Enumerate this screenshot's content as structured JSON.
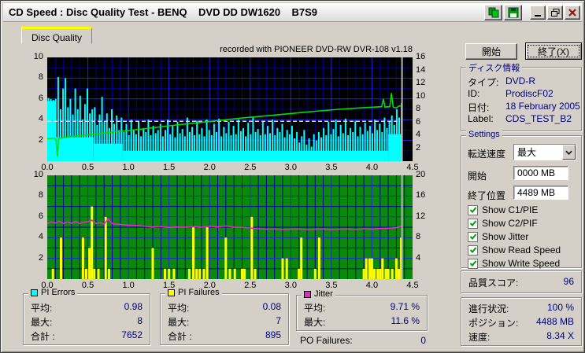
{
  "window": {
    "title": "CD Speed : Disc Quality Test - BENQ    DVD DD DW1620    B7S9"
  },
  "titlebar_icons": [
    "copy-icon",
    "save-icon",
    "minimize-icon",
    "restore-icon",
    "close-icon"
  ],
  "tab": {
    "label": "Disc Quality"
  },
  "buttons": {
    "start": "開始",
    "exit": "終了(X)"
  },
  "disc_info": {
    "title": "ディスク情報",
    "rows": [
      {
        "label": "タイプ:",
        "value": "DVD-R"
      },
      {
        "label": "ID:",
        "value": "ProdiscF02"
      },
      {
        "label": "日付:",
        "value": "18 February 2005"
      },
      {
        "label": "Label:",
        "value": "CDS_TEST_B2"
      }
    ]
  },
  "settings": {
    "title": "Settings",
    "speed_label": "転送速度",
    "speed_value": "最大",
    "start_label": "開始",
    "start_value": "0000 MB",
    "end_label": "終了位置",
    "end_value": "4489 MB",
    "checkboxes": [
      {
        "label": "Show C1/PIE",
        "checked": true
      },
      {
        "label": "Show C2/PIF",
        "checked": true
      },
      {
        "label": "Show Jitter",
        "checked": true
      },
      {
        "label": "Show Read Speed",
        "checked": true
      },
      {
        "label": "Show Write Speed",
        "checked": true
      }
    ]
  },
  "score": {
    "label": "品質スコア:",
    "value": "96"
  },
  "status": {
    "rows": [
      {
        "label": "進行状況:",
        "value": "100 %"
      },
      {
        "label": "ポジション:",
        "value": "4488 MB"
      },
      {
        "label": "速度:",
        "value": "8.34 X"
      }
    ]
  },
  "stats": {
    "pi_errors": {
      "title": "PI Errors",
      "color": "#00ffff",
      "rows": [
        {
          "label": "平均:",
          "value": "0.98"
        },
        {
          "label": "最大:",
          "value": "8"
        },
        {
          "label": "合計 :",
          "value": "7652"
        }
      ]
    },
    "pi_failures": {
      "title": "PI Failures",
      "color": "#ffff00",
      "rows": [
        {
          "label": "平均:",
          "value": "0.08"
        },
        {
          "label": "最大:",
          "value": "7"
        },
        {
          "label": "合計 :",
          "value": "895"
        }
      ]
    },
    "jitter": {
      "title": "Jitter",
      "color": "#ee22cc",
      "rows": [
        {
          "label": "平均:",
          "value": "9.71 %"
        },
        {
          "label": "最大:",
          "value": "11.6 %"
        }
      ]
    },
    "po_failures": {
      "label": "PO Failures:",
      "value": "0"
    }
  },
  "chart_data": [
    {
      "type": "bar",
      "name": "pi-errors-and-speed",
      "annotation": "recorded with PIONEER DVD-RW  DVR-108  v1.18",
      "x_range": [
        0,
        4.5
      ],
      "x_ticks": [
        "0.0",
        "0.5",
        "1.0",
        "1.5",
        "2.0",
        "2.5",
        "3.0",
        "3.5",
        "4.0",
        "4.5"
      ],
      "y_left": {
        "min": 0,
        "max": 10,
        "ticks": [
          10,
          8,
          6,
          4,
          2
        ]
      },
      "y_right": {
        "min": 0,
        "max": 16,
        "ticks": [
          16,
          14,
          12,
          10,
          8,
          6,
          4,
          2
        ]
      },
      "grid": {
        "x_minor": 0.1,
        "x_major": 0.5,
        "y_minor": 1,
        "y_major": 2
      },
      "end_marker_x": 4.37,
      "colors": {
        "bg": "#000000",
        "grid_minor": "#000088",
        "grid_major": "#2424e0",
        "pi_errors": "#00ffff",
        "read_speed": "#00dd00",
        "write_speed": "#d8d8d8",
        "end_marker": "#b8b8b8"
      },
      "pi_errors": {
        "axis": "left",
        "x_start": 0.015,
        "x_step": 0.03,
        "values": [
          6.1,
          6.0,
          5.9,
          6.0,
          8.1,
          5,
          7,
          8,
          5.2,
          6,
          4.5,
          7,
          5,
          6.3,
          4,
          5.5,
          7,
          4.6,
          5,
          5.2,
          3.5,
          4.5,
          6.2,
          3.8,
          4.6,
          3.2,
          5,
          3.6,
          4.4,
          3,
          4.2,
          2.8,
          3.6,
          2.5,
          4,
          3,
          2.6,
          3.8,
          2.4,
          3.2,
          2.8,
          4,
          2.5,
          3.4,
          2.7,
          3,
          3.6,
          2.4,
          3,
          4,
          2.6,
          3.4,
          2.3,
          3.8,
          2.7,
          3.1,
          2.4,
          4.2,
          2.8,
          3.3,
          2.5,
          3.9,
          2.6,
          3.2,
          2.4,
          4,
          3,
          2.5,
          3.6,
          2.8,
          4.1,
          2.4,
          3.3,
          2.7,
          3.8,
          2.5,
          3.4,
          2.6,
          4,
          2.9,
          3.2,
          2.4,
          3.7,
          2.6,
          4.2,
          2.8,
          3.1,
          2.5,
          3.9,
          2.6,
          3.4,
          2.7,
          4,
          2.5,
          3.2,
          2.8,
          3.6,
          2.3,
          3,
          2.6,
          3.4,
          2.2,
          2.8,
          1.8,
          2.4,
          3,
          1.6,
          2.2,
          1.4,
          2.6,
          2,
          2.8,
          2.3,
          3.2,
          2.5,
          3.8,
          2.6,
          3.1,
          4,
          2.4,
          3.5,
          2.7,
          4.1,
          2.5,
          3.2,
          2.8,
          3.9,
          2.4,
          3.3,
          2.6,
          3.7,
          2.9,
          3.4,
          2.7,
          4,
          3,
          3.6,
          2.8,
          4.2,
          3.2,
          3.8,
          4.4,
          3.5,
          5,
          4.2,
          5.6
        ],
        "base_segments": [
          [
            0,
            0.1,
            5.8
          ],
          [
            0.1,
            0.57,
            2.3
          ],
          [
            0.57,
            0.93,
            1.7
          ],
          [
            0.93,
            4.2,
            1.0
          ],
          [
            4.2,
            4.37,
            2.6
          ]
        ]
      },
      "read_speed": {
        "axis": "right",
        "points": [
          [
            0,
            3.45
          ],
          [
            0.09,
            3.55
          ],
          [
            0.11,
            3.3
          ],
          [
            0.125,
            0.7
          ],
          [
            0.14,
            3.5
          ],
          [
            0.3,
            3.8
          ],
          [
            0.6,
            4.2
          ],
          [
            0.9,
            4.6
          ],
          [
            1.2,
            5.0
          ],
          [
            1.5,
            5.45
          ],
          [
            1.8,
            5.85
          ],
          [
            2.1,
            6.25
          ],
          [
            2.4,
            6.65
          ],
          [
            2.7,
            7.0
          ],
          [
            3.0,
            7.35
          ],
          [
            3.3,
            7.7
          ],
          [
            3.6,
            8.0
          ],
          [
            3.9,
            8.25
          ],
          [
            4.05,
            8.35
          ],
          [
            4.12,
            8.4
          ],
          [
            4.14,
            9.6
          ],
          [
            4.16,
            8.35
          ],
          [
            4.22,
            8.4
          ],
          [
            4.24,
            10.5
          ],
          [
            4.26,
            8.35
          ],
          [
            4.3,
            8.2
          ],
          [
            4.33,
            8.5
          ],
          [
            4.37,
            8.5
          ]
        ]
      },
      "write_speed": {
        "axis": "right",
        "y": 6.15,
        "x_end": 4.33
      }
    },
    {
      "type": "bar",
      "name": "pi-failures-and-jitter",
      "x_range": [
        0,
        4.5
      ],
      "x_ticks": [
        "0.0",
        "0.5",
        "1.0",
        "1.5",
        "2.0",
        "2.5",
        "3.0",
        "3.5",
        "4.0",
        "4.5"
      ],
      "y_left": {
        "min": 0,
        "max": 10,
        "ticks": [
          10,
          8,
          6,
          4,
          2
        ]
      },
      "y_right": {
        "min": 0,
        "max": 20,
        "ticks": [
          20,
          16,
          12,
          8,
          4
        ]
      },
      "grid": {
        "x_minor": 0.1,
        "x_major": 0.5,
        "y_minor": 1,
        "y_major": 2
      },
      "end_marker_x": 4.37,
      "colors": {
        "bg": "#0a8a0a",
        "grid_minor": "#0000a0",
        "grid_major": "#2424e0",
        "pi_failures": "#ffff00",
        "jitter": "#ee22cc",
        "end_marker": "#b8b8b8"
      },
      "pi_failures": {
        "axis": "left",
        "points": [
          [
            0.07,
            1
          ],
          [
            0.17,
            4
          ],
          [
            0.44,
            4
          ],
          [
            0.48,
            1
          ],
          [
            0.52,
            3
          ],
          [
            0.55,
            7
          ],
          [
            0.58,
            1
          ],
          [
            0.63,
            1
          ],
          [
            0.72,
            6
          ],
          [
            0.76,
            1
          ],
          [
            1.3,
            3
          ],
          [
            1.45,
            1
          ],
          [
            1.5,
            1
          ],
          [
            1.56,
            1
          ],
          [
            1.75,
            1
          ],
          [
            1.8,
            5
          ],
          [
            1.84,
            1
          ],
          [
            1.88,
            1
          ],
          [
            1.93,
            1
          ],
          [
            1.97,
            5
          ],
          [
            2.2,
            4
          ],
          [
            2.25,
            1
          ],
          [
            2.31,
            1
          ],
          [
            2.4,
            1
          ],
          [
            2.43,
            1
          ],
          [
            2.52,
            6
          ],
          [
            2.56,
            1
          ],
          [
            2.9,
            2
          ],
          [
            2.95,
            2
          ],
          [
            3.1,
            1
          ],
          [
            3.13,
            4
          ],
          [
            3.3,
            1
          ],
          [
            3.35,
            4
          ],
          [
            3.9,
            1
          ],
          [
            3.93,
            2
          ],
          [
            3.97,
            2
          ],
          [
            4.0,
            2
          ],
          [
            4.03,
            1
          ],
          [
            4.07,
            1
          ],
          [
            4.1,
            1
          ],
          [
            4.13,
            2
          ],
          [
            4.17,
            1
          ],
          [
            4.2,
            1
          ],
          [
            4.25,
            1
          ],
          [
            4.3,
            2
          ],
          [
            4.33,
            1
          ],
          [
            4.36,
            4
          ]
        ]
      },
      "jitter": {
        "axis": "right",
        "points": [
          [
            0,
            10.7
          ],
          [
            0.05,
            11.0
          ],
          [
            0.1,
            10.8
          ],
          [
            0.15,
            11.15
          ],
          [
            0.2,
            10.7
          ],
          [
            0.25,
            11.0
          ],
          [
            0.3,
            10.75
          ],
          [
            0.35,
            11.1
          ],
          [
            0.4,
            10.7
          ],
          [
            0.45,
            10.95
          ],
          [
            0.5,
            11.05
          ],
          [
            0.55,
            11.35
          ],
          [
            0.6,
            10.7
          ],
          [
            0.65,
            10.9
          ],
          [
            0.7,
            10.6
          ],
          [
            0.75,
            11.6
          ],
          [
            0.8,
            10.7
          ],
          [
            0.9,
            10.55
          ],
          [
            1.0,
            10.4
          ],
          [
            1.1,
            10.35
          ],
          [
            1.2,
            10.2
          ],
          [
            1.3,
            10.05
          ],
          [
            1.4,
            10.15
          ],
          [
            1.5,
            9.95
          ],
          [
            1.6,
            10.05
          ],
          [
            1.7,
            10.0
          ],
          [
            1.8,
            10.15
          ],
          [
            1.9,
            10.0
          ],
          [
            2.0,
            10.2
          ],
          [
            2.1,
            10.05
          ],
          [
            2.2,
            10.25
          ],
          [
            2.3,
            10.0
          ],
          [
            2.4,
            9.95
          ],
          [
            2.5,
            9.85
          ],
          [
            2.6,
            9.7
          ],
          [
            2.7,
            9.6
          ],
          [
            2.8,
            9.65
          ],
          [
            2.9,
            9.55
          ],
          [
            3.0,
            9.6
          ],
          [
            3.1,
            9.65
          ],
          [
            3.2,
            9.55
          ],
          [
            3.3,
            9.6
          ],
          [
            3.4,
            9.65
          ],
          [
            3.5,
            9.55
          ],
          [
            3.6,
            9.6
          ],
          [
            3.7,
            9.65
          ],
          [
            3.8,
            9.55
          ],
          [
            3.9,
            9.7
          ],
          [
            4.0,
            9.6
          ],
          [
            4.1,
            9.75
          ],
          [
            4.2,
            9.8
          ],
          [
            4.3,
            9.9
          ],
          [
            4.35,
            10.1
          ],
          [
            4.37,
            10.2
          ]
        ]
      }
    }
  ]
}
